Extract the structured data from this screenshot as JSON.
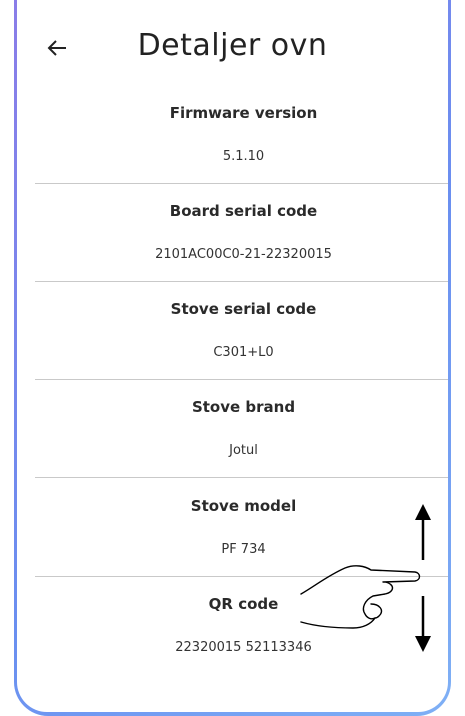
{
  "header": {
    "title": "Detaljer ovn",
    "back_icon": "arrow-left-icon"
  },
  "details": [
    {
      "label": "Firmware version",
      "value": "5.1.10"
    },
    {
      "label": "Board serial code",
      "value": "2101AC00C0-21-22320015"
    },
    {
      "label": "Stove serial code",
      "value": "C301+L0"
    },
    {
      "label": "Stove brand",
      "value": "Jotul"
    },
    {
      "label": "Stove model",
      "value": "PF 734"
    },
    {
      "label": "QR code",
      "value": "22320015 52113346"
    }
  ],
  "overlay": {
    "gesture_icon": "swipe-vertical-hand-icon"
  },
  "colors": {
    "frame_gradient_start": "#8a7de8",
    "frame_gradient_end": "#7fb0f5",
    "divider": "#c9c9c9"
  }
}
